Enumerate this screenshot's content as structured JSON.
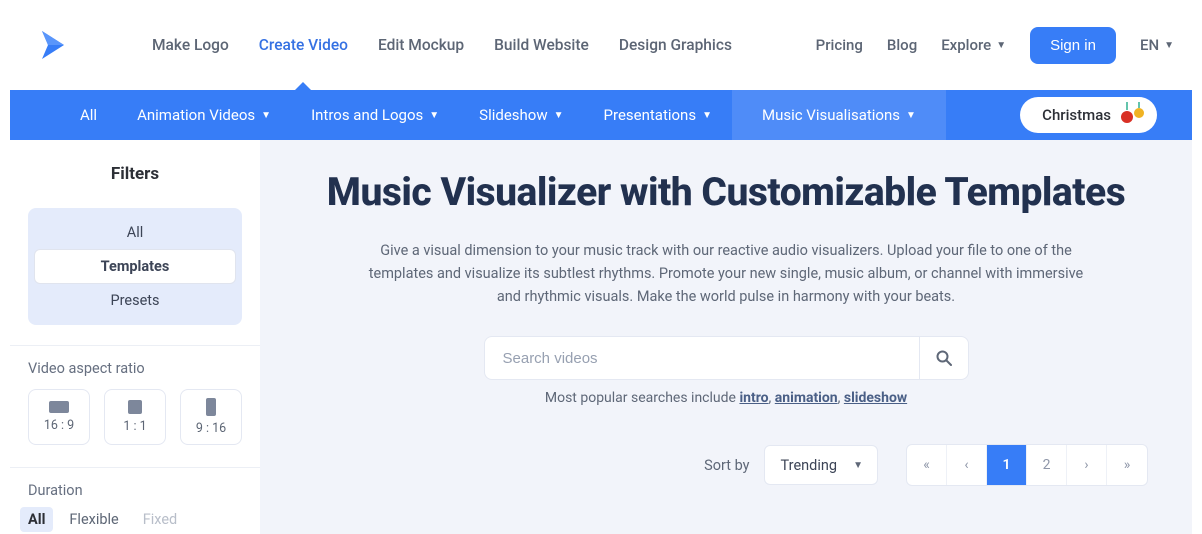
{
  "topnav": {
    "links": [
      "Make Logo",
      "Create Video",
      "Edit Mockup",
      "Build Website",
      "Design Graphics"
    ],
    "active_index": 1,
    "right": {
      "pricing": "Pricing",
      "blog": "Blog",
      "explore": "Explore",
      "signin": "Sign in",
      "lang": "EN"
    }
  },
  "categories": {
    "items": [
      "All",
      "Animation Videos",
      "Intros and Logos",
      "Slideshow",
      "Presentations",
      "Music Visualisations"
    ],
    "active_index": 5,
    "christmas": "Christmas"
  },
  "sidebar": {
    "title": "Filters",
    "tabs": {
      "all": "All",
      "templates": "Templates",
      "presets": "Presets"
    },
    "aspect_label": "Video aspect ratio",
    "ratios": {
      "wide": "16 : 9",
      "square": "1 : 1",
      "tall": "9 : 16"
    },
    "duration_label": "Duration",
    "durations": {
      "all": "All",
      "flexible": "Flexible",
      "fixed": "Fixed"
    }
  },
  "main": {
    "title": "Music Visualizer with Customizable Templates",
    "description": "Give a visual dimension to your music track with our reactive audio visualizers. Upload your file to one of the templates and visualize its subtlest rhythms. Promote your new single, music album, or channel with immersive and rhythmic visuals. Make the world pulse in harmony with your beats.",
    "search_placeholder": "Search videos",
    "popular_prefix": "Most popular searches include ",
    "popular": {
      "intro": "intro",
      "animation": "animation",
      "slideshow": "slideshow"
    },
    "sort_label": "Sort by",
    "sort_value": "Trending",
    "pages": {
      "p1": "1",
      "p2": "2"
    }
  },
  "colors": {
    "primary": "#377df7",
    "text": "#22314f"
  }
}
